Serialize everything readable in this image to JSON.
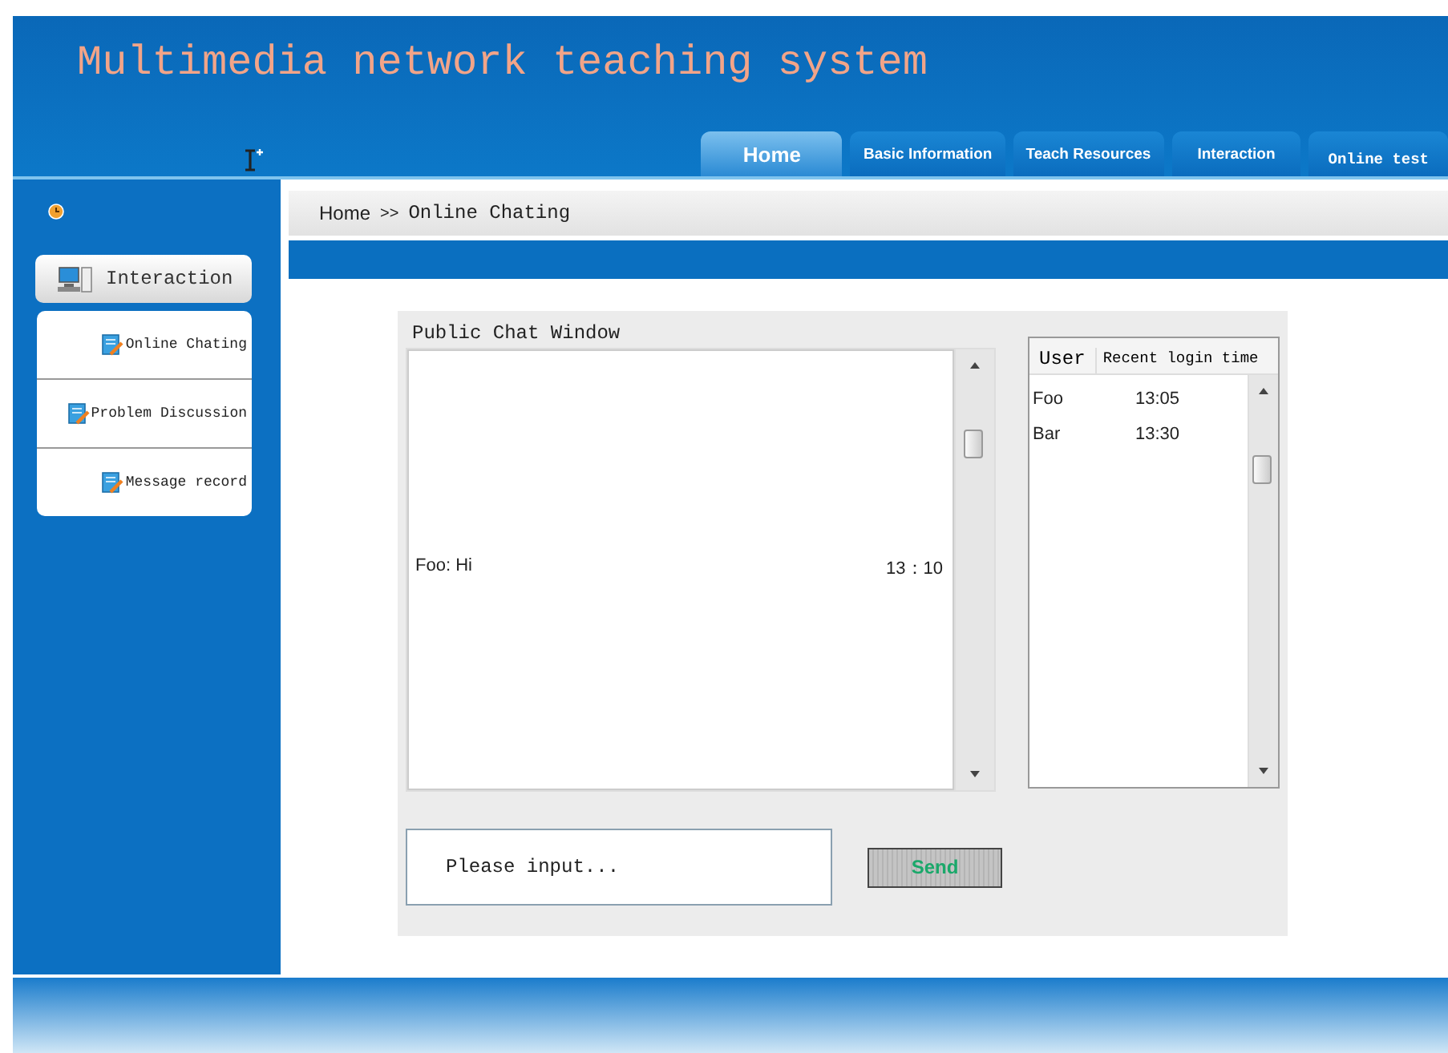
{
  "header": {
    "title": "Multimedia network teaching system"
  },
  "nav_tabs": [
    {
      "label": "Home",
      "selected": true
    },
    {
      "label": "Basic Information",
      "selected": false
    },
    {
      "label": "Teach Resources",
      "selected": false
    },
    {
      "label": "Interaction",
      "selected": false
    },
    {
      "label": "Online test",
      "selected": false
    }
  ],
  "breadcrumb": {
    "items": [
      "Home",
      "Online Chating"
    ],
    "separator": ">>"
  },
  "sidebar": {
    "section": "Interaction",
    "items": [
      {
        "label": "Online Chating"
      },
      {
        "label": "Problem Discussion"
      },
      {
        "label": "Message record"
      }
    ]
  },
  "chat": {
    "title": "Public Chat Window",
    "messages": [
      {
        "text": "Foo: Hi",
        "time": "13：10"
      }
    ],
    "input": {
      "placeholder": "Please input..."
    },
    "send_button": "Send"
  },
  "users": {
    "columns": [
      "User",
      "Recent login time"
    ],
    "rows": [
      {
        "user": "Foo",
        "time": "13:05"
      },
      {
        "user": "Bar",
        "time": "13:30"
      }
    ]
  }
}
